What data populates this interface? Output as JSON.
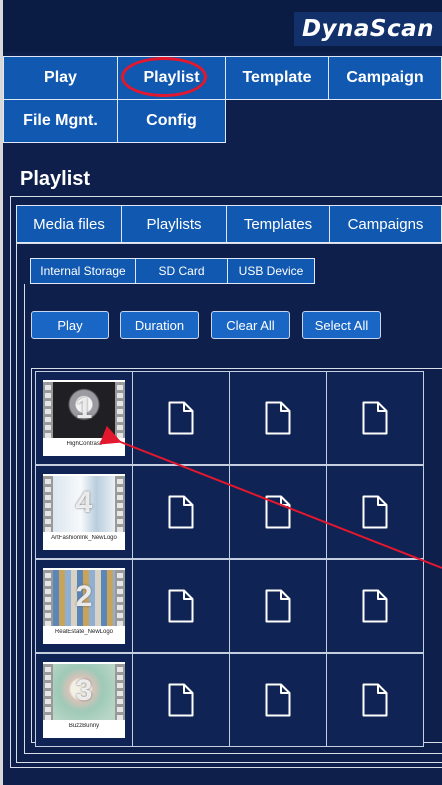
{
  "brand": {
    "logo": "DynaScan"
  },
  "nav": {
    "items": [
      {
        "label": "Play"
      },
      {
        "label": "Playlist"
      },
      {
        "label": "Template"
      },
      {
        "label": "Campaign"
      },
      {
        "label": "File Mgnt."
      },
      {
        "label": "Config"
      }
    ],
    "active": "Playlist"
  },
  "page": {
    "title": "Playlist"
  },
  "tabs": [
    {
      "label": "Media files"
    },
    {
      "label": "Playlists"
    },
    {
      "label": "Templates"
    },
    {
      "label": "Campaigns"
    }
  ],
  "storage_tabs": [
    {
      "label": "Internal Storage"
    },
    {
      "label": "SD Card"
    },
    {
      "label": "USB Device"
    }
  ],
  "actions": {
    "play": "Play",
    "duration": "Duration",
    "clear_all": "Clear All",
    "select_all": "Select All"
  },
  "playlist_items": [
    {
      "number": "1",
      "name": "HighContrast"
    },
    {
      "number": "4",
      "name": "ArtFashionInk_NewLogo"
    },
    {
      "number": "2",
      "name": "RealEstate_NewLogo"
    },
    {
      "number": "3",
      "name": "BuzzBunny"
    }
  ],
  "empty_slot_icon": "document-icon",
  "colors": {
    "background": "#0d1f4a",
    "button": "#1158b0",
    "highlight": "#e3172e"
  }
}
